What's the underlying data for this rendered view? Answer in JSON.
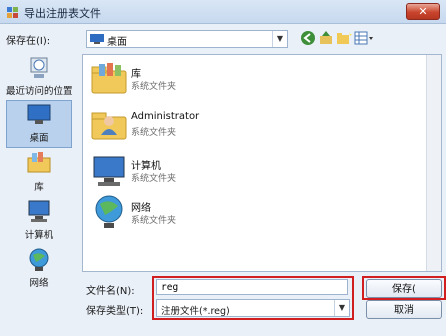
{
  "window": {
    "title": "导出注册表文件",
    "close_glyph": "✕"
  },
  "toolbar": {
    "save_in_label": "保存在(I):",
    "location": "桌面",
    "dropdown_glyph": "▼"
  },
  "places": [
    {
      "label": "最近访问的位置",
      "icon": "recent-places-icon"
    },
    {
      "label": "桌面",
      "icon": "desktop-icon",
      "selected": true
    },
    {
      "label": "库",
      "icon": "libraries-icon"
    },
    {
      "label": "计算机",
      "icon": "computer-icon"
    },
    {
      "label": "网络",
      "icon": "network-icon"
    }
  ],
  "files": [
    {
      "name": "库",
      "type": "系统文件夹",
      "icon": "libraries-folder-icon"
    },
    {
      "name": "Administrator",
      "type": "系统文件夹",
      "icon": "user-folder-icon"
    },
    {
      "name": "计算机",
      "type": "系统文件夹",
      "icon": "computer-icon"
    },
    {
      "name": "网络",
      "type": "系统文件夹",
      "icon": "network-icon"
    }
  ],
  "form": {
    "filename_label": "文件名(N):",
    "filename_value": "reg",
    "filetype_label": "保存类型(T):",
    "filetype_value": "注册文件(*.reg)",
    "save_button": "保存(",
    "cancel_button": "取消"
  },
  "colors": {
    "highlight_red": "#d11f1f",
    "selection_blue": "#b9d1ec"
  }
}
